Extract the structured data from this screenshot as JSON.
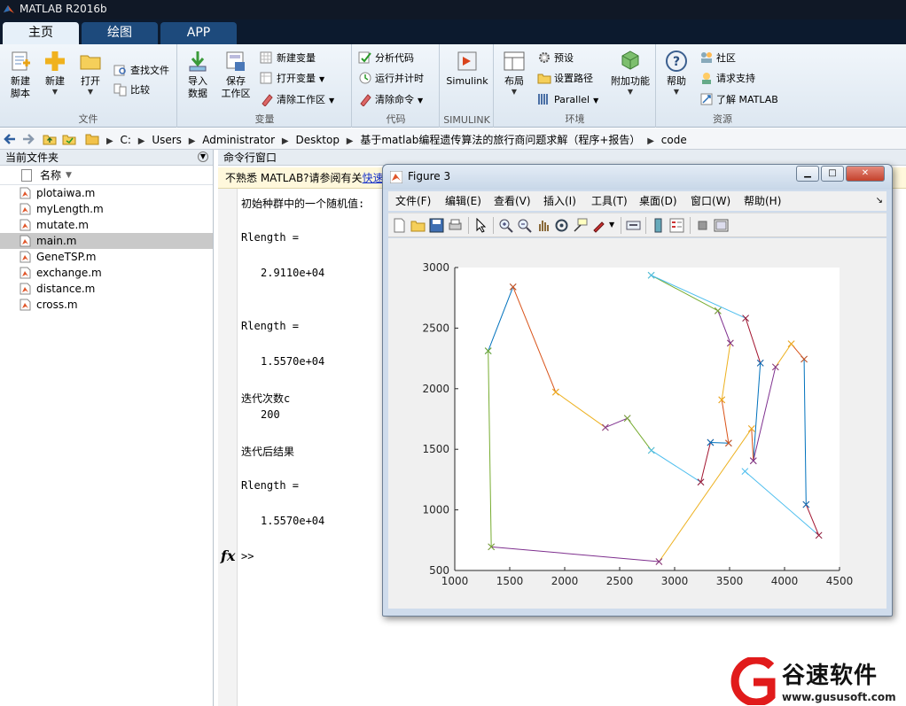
{
  "window": {
    "title": "MATLAB R2016b"
  },
  "tabs": [
    {
      "label": "主页",
      "active": true
    },
    {
      "label": "绘图",
      "active": false
    },
    {
      "label": "APP",
      "active": false
    }
  ],
  "ribbon": {
    "file": {
      "section_label": "文件",
      "new_script": "新建\n脚本",
      "new": "新建",
      "open": "打开",
      "find_files": "查找文件",
      "compare": "比较"
    },
    "variable": {
      "section_label": "变量",
      "import_data": "导入\n数据",
      "save_workspace": "保存\n工作区",
      "new_variable": "新建变量",
      "open_variable": "打开变量",
      "clear_workspace": "清除工作区"
    },
    "code": {
      "section_label": "代码",
      "analyze_code": "分析代码",
      "run_and_time": "运行并计时",
      "clear_commands": "清除命令"
    },
    "simulink": {
      "section_label": "SIMULINK",
      "simulink": "Simulink"
    },
    "environment": {
      "section_label": "环境",
      "layout": "布局",
      "preferences": "预设",
      "set_path": "设置路径",
      "parallel": "Parallel",
      "addons": "附加功能"
    },
    "resources": {
      "section_label": "资源",
      "help": "帮助",
      "community": "社区",
      "request_support": "请求支持",
      "learn_matlab": "了解 MATLAB"
    }
  },
  "address": {
    "crumbs": [
      "C:",
      "Users",
      "Administrator",
      "Desktop",
      "基于matlab编程遗传算法的旅行商问题求解（程序+报告）",
      "code"
    ]
  },
  "file_panel": {
    "title": "当前文件夹",
    "column_name": "名称",
    "files": [
      {
        "name": "plotaiwa.m",
        "selected": false
      },
      {
        "name": "myLength.m",
        "selected": false
      },
      {
        "name": "mutate.m",
        "selected": false
      },
      {
        "name": "main.m",
        "selected": true
      },
      {
        "name": "GeneTSP.m",
        "selected": false
      },
      {
        "name": "exchange.m",
        "selected": false
      },
      {
        "name": "distance.m",
        "selected": false
      },
      {
        "name": "cross.m",
        "selected": false
      }
    ]
  },
  "command_window": {
    "title": "命令行窗口",
    "notice_text": "不熟悉 MATLAB?请参阅有关",
    "notice_link": "快速",
    "lines": [
      "初始种群中的一个随机值:",
      "Rlength =",
      "2.9110e+04",
      "Rlength =",
      "1.5570e+04",
      "迭代次数c",
      "200",
      "迭代后结果",
      "Rlength =",
      "1.5570e+04"
    ],
    "fx": "fx",
    "prompt": ">>"
  },
  "figure": {
    "title": "Figure 3",
    "menu": [
      "文件(F)",
      "编辑(E)",
      "查看(V)",
      "插入(I)",
      "工具(T)",
      "桌面(D)",
      "窗口(W)",
      "帮助(H)"
    ],
    "toolbar_icons": [
      "new-figure-icon",
      "open-file-icon",
      "save-icon",
      "print-icon",
      "pointer-icon",
      "zoom-in-icon",
      "zoom-out-icon",
      "pan-icon",
      "rotate-icon",
      "data-cursor-icon",
      "brush-icon",
      "link-plot-icon",
      "colorbar-icon",
      "legend-icon",
      "hide-tools-icon",
      "show-tools-icon"
    ]
  },
  "chart_data": {
    "type": "line",
    "title": "",
    "xlabel": "",
    "ylabel": "",
    "xlim": [
      1000,
      4500
    ],
    "ylim": [
      500,
      3000
    ],
    "xticks": [
      "1000",
      "1500",
      "2000",
      "2500",
      "3000",
      "3500",
      "4000",
      "4500"
    ],
    "yticks": [
      "500",
      "1000",
      "1500",
      "2000",
      "2500",
      "3000"
    ],
    "grid": false,
    "marker": "x",
    "tour": [
      [
        1304,
        2312
      ],
      [
        1530,
        2840
      ],
      [
        1918,
        1972
      ],
      [
        2370,
        1680
      ],
      [
        2570,
        1756
      ],
      [
        2788,
        1491
      ],
      [
        3238,
        1229
      ],
      [
        3326,
        1556
      ],
      [
        3491,
        1551
      ],
      [
        3429,
        1908
      ],
      [
        3507,
        2376
      ],
      [
        3394,
        2643
      ],
      [
        2787,
        2936
      ],
      [
        3646,
        2582
      ],
      [
        3780,
        2212
      ],
      [
        3716,
        1405
      ],
      [
        3700,
        1670
      ],
      [
        2858,
        573
      ],
      [
        1332,
        695
      ],
      [
        1304,
        2312
      ]
    ],
    "extra_segments": [
      [
        [
          4312,
          790
        ],
        [
          3640,
          1318
        ]
      ],
      [
        [
          4196,
          1044
        ],
        [
          4312,
          790
        ]
      ],
      [
        [
          4178,
          2244
        ],
        [
          4196,
          1044
        ]
      ],
      [
        [
          4061,
          2370
        ],
        [
          4178,
          2244
        ]
      ],
      [
        [
          3918,
          2179
        ],
        [
          4061,
          2370
        ]
      ],
      [
        [
          3716,
          1405
        ],
        [
          3918,
          2179
        ]
      ]
    ],
    "colors": [
      "#0072BD",
      "#D95319",
      "#EDB120",
      "#7E2F8E",
      "#77AC30",
      "#4DBEEE",
      "#A2142F"
    ]
  },
  "watermark": {
    "name": "谷速软件",
    "url": "www.gususoft.com"
  }
}
